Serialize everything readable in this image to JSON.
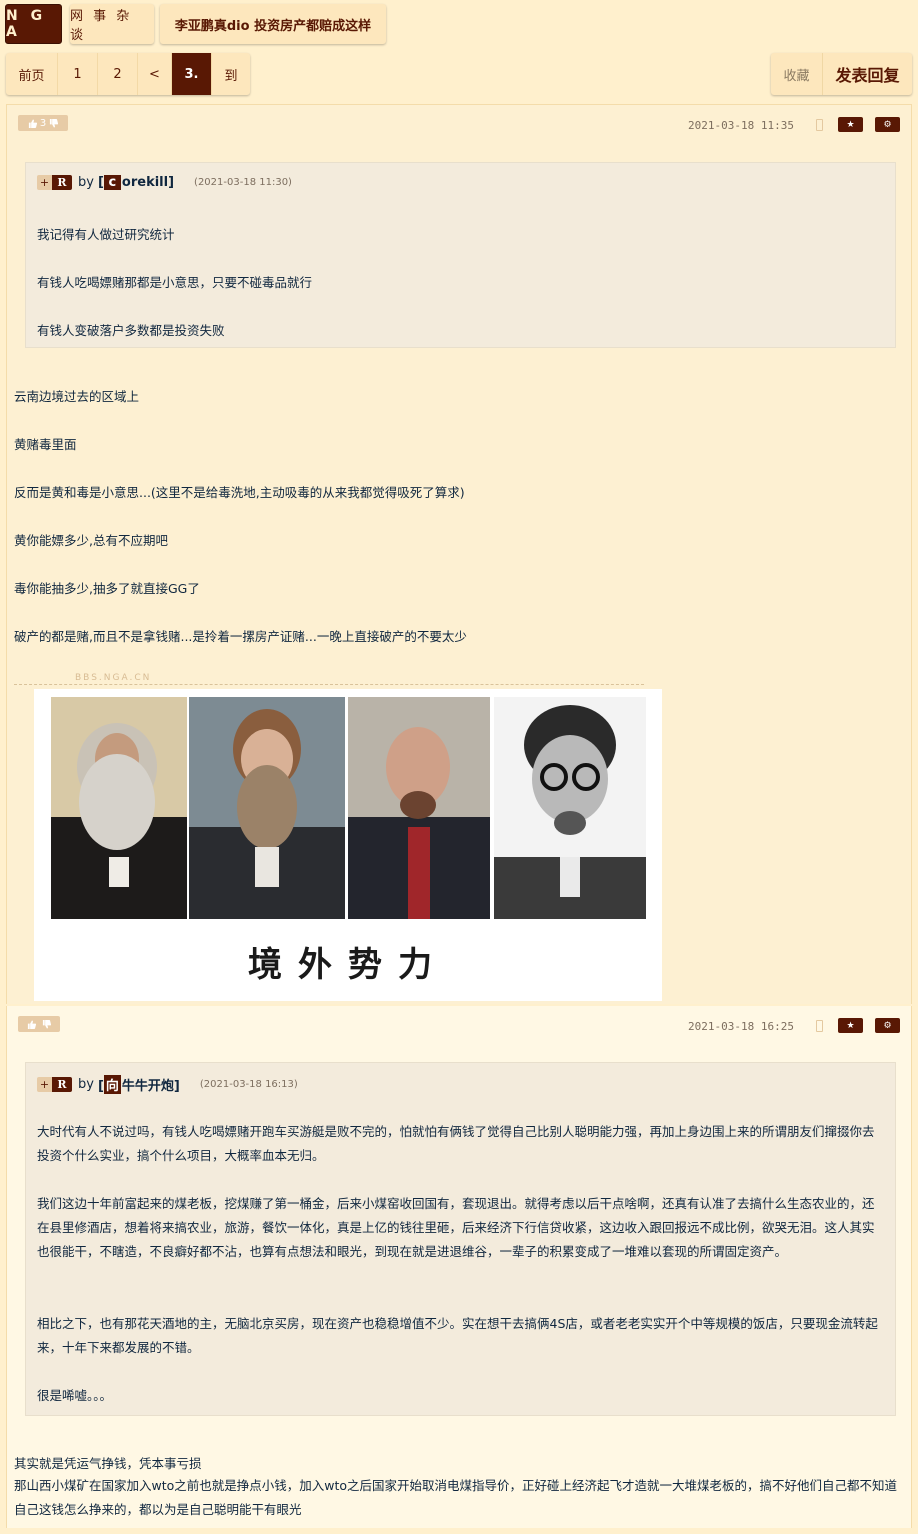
{
  "nav": {
    "logo": "N G A",
    "forum": "网 事 杂 谈",
    "thread_title": "李亚鹏真dio 投资房产都赔成这样"
  },
  "pager": {
    "first": "前页",
    "pages": [
      "1",
      "2"
    ],
    "prev": "<",
    "current": "3.",
    "goto": "到"
  },
  "actions": {
    "favorite": "收藏",
    "reply": "发表回复"
  },
  "posts": [
    {
      "votes": "3",
      "time": "2021-03-18 11:35",
      "quote": {
        "plus": "+",
        "tag": "R",
        "by": "by",
        "user_initial": "c",
        "user_rest": "orekill",
        "time": "(2021-03-18 11:30)",
        "lines": [
          "我记得有人做过研究统计",
          "有钱人吃喝嫖赌那都是小意思，只要不碰毒品就行",
          "有钱人变破落户多数都是投资失败"
        ]
      },
      "body": [
        "云南边境过去的区域上",
        "黄赌毒里面",
        "反而是黄和毒是小意思...(这里不是给毒洗地,主动吸毒的从来我都觉得吸死了算求)",
        "黄你能嫖多少,总有不应期吧",
        "毒你能抽多少,抽多了就直接GG了",
        "破产的都是赌,而且不是拿钱赌...是拎着一摞房产证赌...一晚上直接破产的不要太少"
      ],
      "watermark": "BBS.NGA.CN",
      "image_caption": "境外势力"
    },
    {
      "votes": "",
      "time": "2021-03-18 16:25",
      "quote": {
        "plus": "+",
        "tag": "R",
        "by": "by",
        "user_initial": "向",
        "user_rest": "牛牛开炮",
        "time": "(2021-03-18 16:13)",
        "paragraphs": [
          "大时代有人不说过吗，有钱人吃喝嫖赌开跑车买游艇是败不完的，怕就怕有俩钱了觉得自己比别人聪明能力强，再加上身边围上来的所谓朋友们撺掇你去投资个什么实业，搞个什么项目，大概率血本无归。",
          "我们这边十年前富起来的煤老板，挖煤赚了第一桶金，后来小煤窑收回国有，套现退出。就得考虑以后干点啥啊，还真有认准了去搞什么生态农业的，还在县里修酒店，想着将来搞农业，旅游，餐饮一体化，真是上亿的钱往里砸，后来经济下行信贷收紧，这边收入跟回报远不成比例，欲哭无泪。这人其实也很能干，不瞎造，不良癖好都不沾，也算有点想法和眼光，到现在就是进退维谷，一辈子的积累变成了一堆难以套现的所谓固定资产。",
          "相比之下，也有那花天酒地的主，无脑北京买房，现在资产也稳稳增值不少。实在想干去搞俩4S店，或者老老实实开个中等规模的饭店，只要现金流转起来，十年下来都发展的不错。",
          "很是唏嘘。。。"
        ]
      },
      "body": [
        "其实就是凭运气挣钱，凭本事亏损",
        "那山西小煤矿在国家加入wto之前也就是挣点小钱，加入wto之后国家开始取消电煤指导价，正好碰上经济起飞才造就一大堆煤老板的，搞不好他们自己都不知道自己这钱怎么挣来的，都以为是自己聪明能干有眼光"
      ]
    }
  ],
  "colors": {
    "brand": "#591804",
    "page_bg": "#fff0cd",
    "post_bg": "#fdf0d2",
    "quote_bg": "#f3ebdc",
    "text": "#10273f"
  }
}
